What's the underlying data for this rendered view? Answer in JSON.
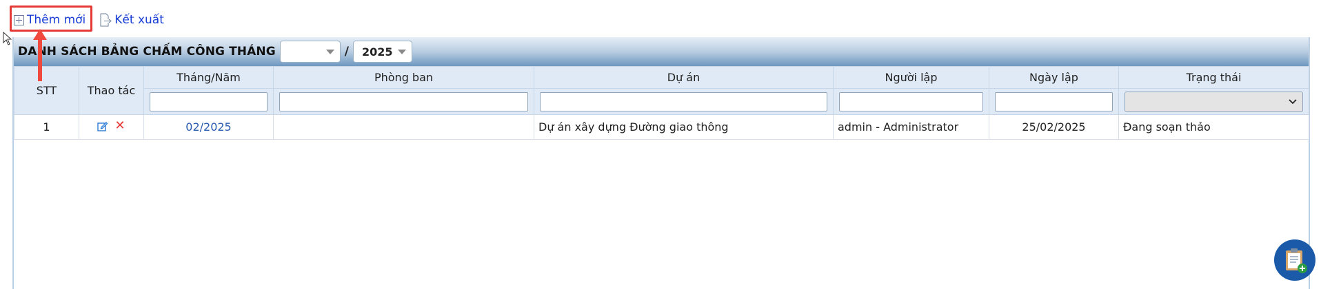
{
  "toolbar": {
    "add_label": "Thêm mới",
    "export_label": "Kết xuất"
  },
  "panel": {
    "title": "DANH SÁCH BẢNG CHẤM CÔNG THÁNG",
    "month_value": "",
    "separator": "/",
    "year_value": "2025"
  },
  "table": {
    "headers": {
      "stt": "STT",
      "actions": "Thao tác",
      "month_year": "Tháng/Năm",
      "department": "Phòng ban",
      "project": "Dự án",
      "creator": "Người lập",
      "created_date": "Ngày lập",
      "status": "Trạng thái"
    },
    "filters": {
      "month_year": "",
      "department": "",
      "project": "",
      "creator": "",
      "created_date": "",
      "status": ""
    },
    "rows": [
      {
        "stt": "1",
        "month_year": "02/2025",
        "department": "",
        "project": "Dự án xây dựng Đường giao thông",
        "creator": "admin - Administrator",
        "created_date": "25/02/2025",
        "status": "Đang soạn thảo"
      }
    ]
  },
  "icons": {
    "add": "plus-square-icon",
    "export": "export-file-icon",
    "edit": "edit-icon",
    "delete": "close-icon",
    "fab": "clipboard-add-icon"
  },
  "colors": {
    "link": "#1a3fd6",
    "highlight": "#e53935",
    "header_bg": "#dfeaf6",
    "fab": "#1a5aa8"
  }
}
